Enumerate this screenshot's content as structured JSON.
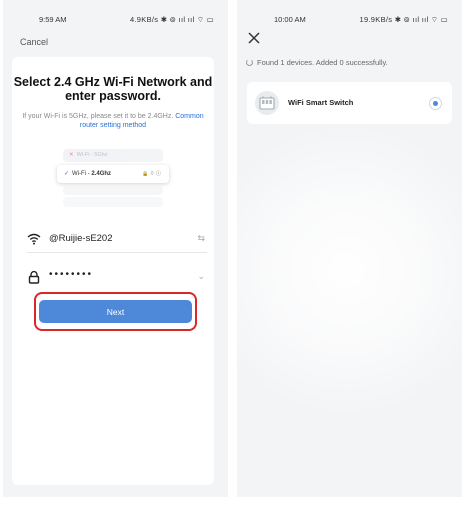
{
  "left_screen": {
    "status_bar": {
      "time": "9:59 AM",
      "indicators": "4.9KB/s ✱ ⊚ ııl ııl ⌔ ▭"
    },
    "cancel_label": "Cancel",
    "headline": "Select 2.4 GHz Wi-Fi Network and enter password.",
    "hint_text": "If your Wi-Fi is 5GHz, please set it to be 2.4GHz.",
    "hint_link": "Common router setting method",
    "illustration": {
      "row_5g": "Wi-Fi - 5Ghz",
      "row_24g_prefix": "Wi-Fi - ",
      "row_24g_band": "2.4Ghz"
    },
    "ssid": {
      "value": "@Ruijie-sE202",
      "icon": "wifi-icon",
      "action_icon": "swap-icon"
    },
    "password": {
      "value": "••••••••",
      "icon": "lock-icon",
      "action_icon": "chevron-down-icon"
    },
    "next_label": "Next",
    "highlight_color": "#d8282b",
    "accent_color": "#4e88d8"
  },
  "right_screen": {
    "status_bar": {
      "time": "10:00 AM",
      "indicators": "19.9KB/s ✱ ⊚ ııl ııl ⌔ ▭"
    },
    "found_text": "Found 1 devices. Added 0 successfully.",
    "device": {
      "name": "WiFi Smart Switch",
      "icon": "switch-device-icon"
    }
  }
}
